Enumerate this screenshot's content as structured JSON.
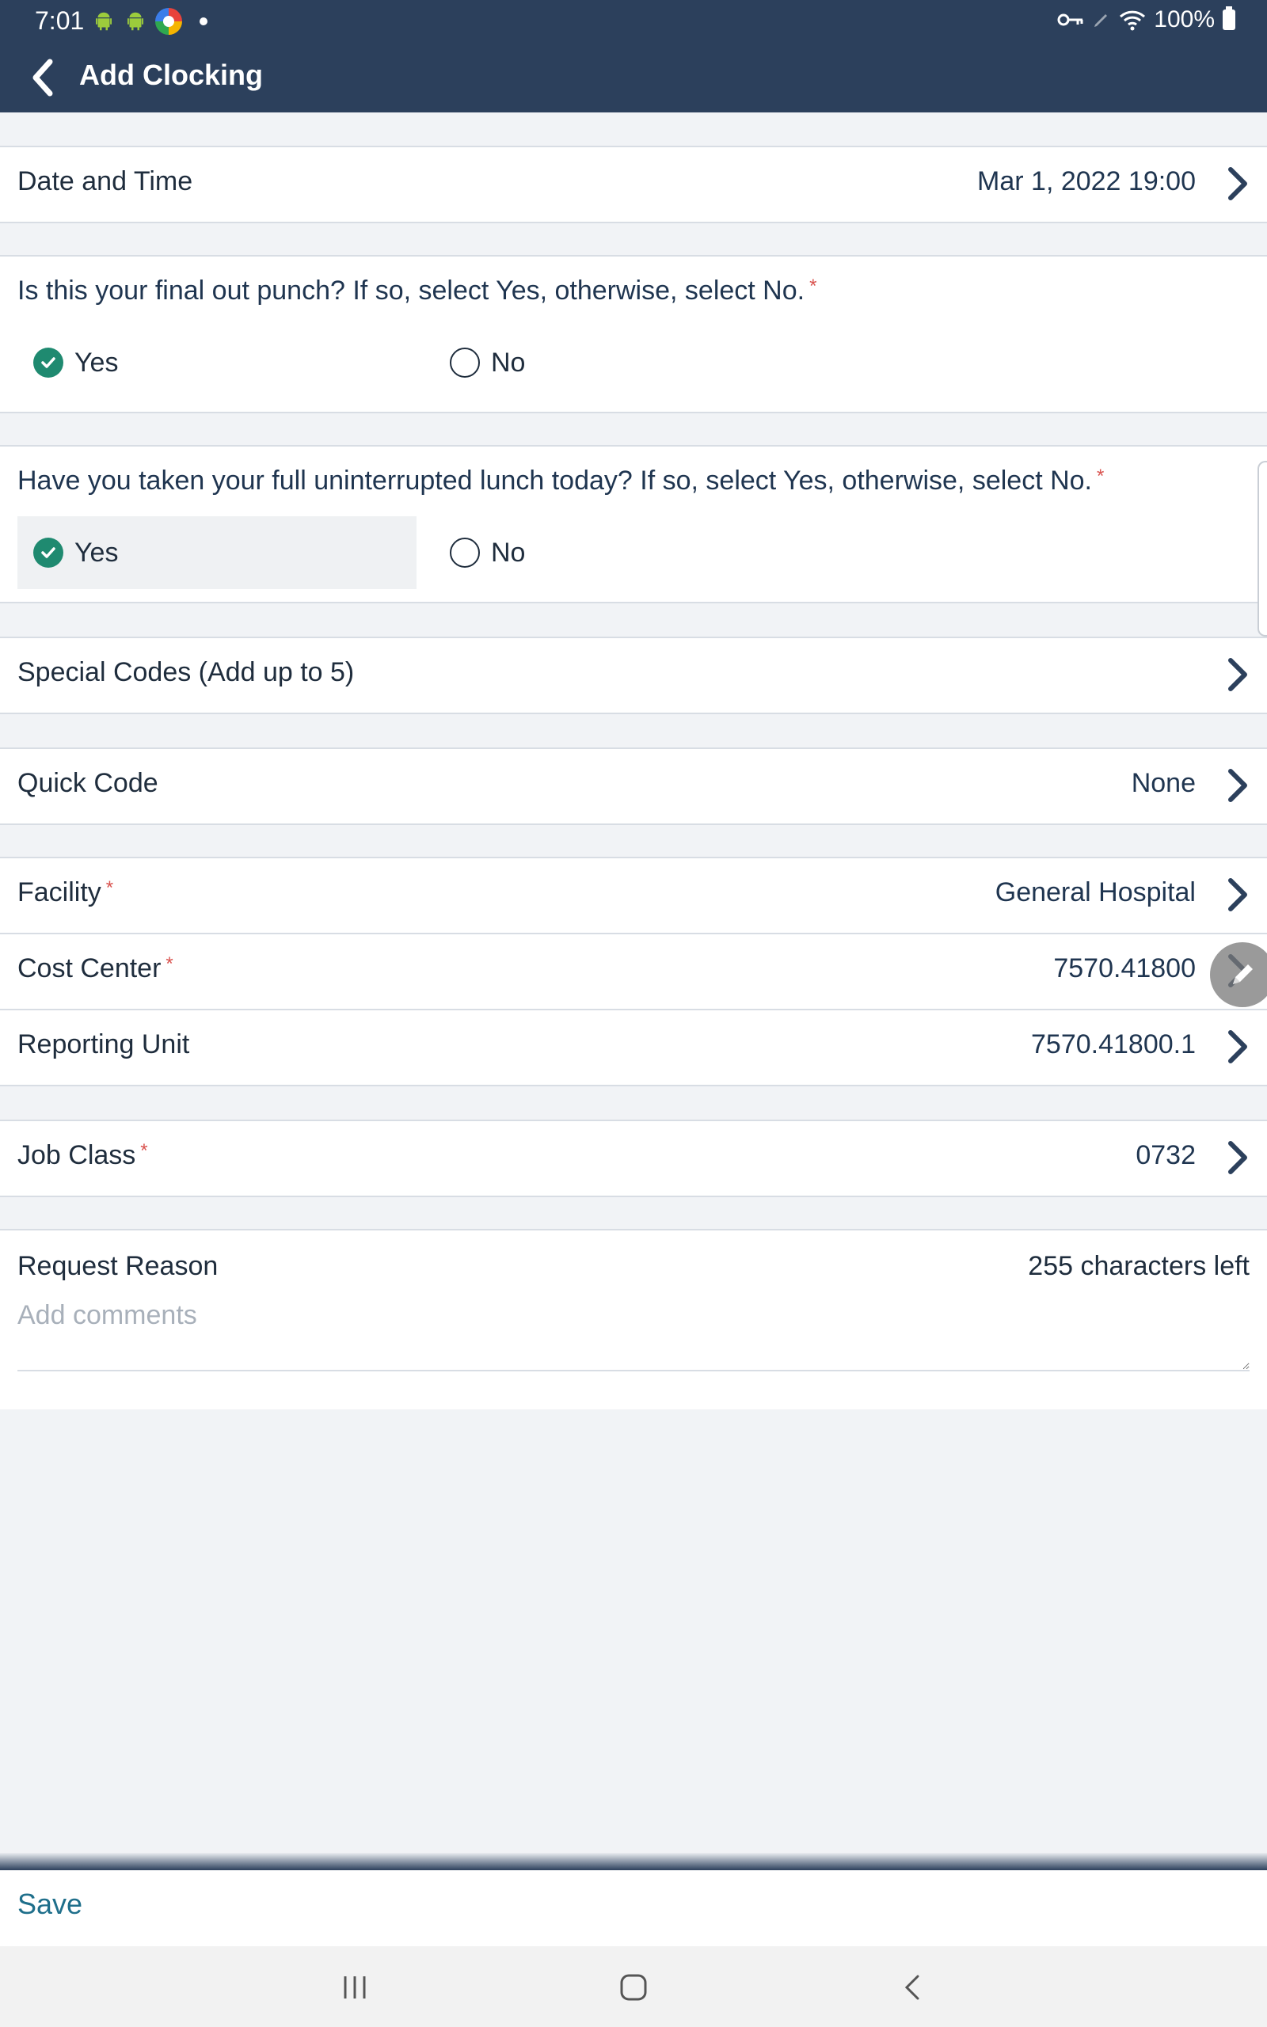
{
  "status_bar": {
    "time": "7:01",
    "battery": "100%",
    "icons": [
      "android-icon",
      "android-icon",
      "browser-icon",
      "dot-icon",
      "key-icon",
      "pencil-icon",
      "wifi-icon",
      "battery-icon"
    ]
  },
  "header": {
    "title": "Add Clocking",
    "back_icon": "chevron-left-icon",
    "background": "#2c405c"
  },
  "date_time": {
    "label": "Date and Time",
    "value": "Mar 1, 2022 19:00"
  },
  "final_punch": {
    "question": "Is this your final out punch? If so, select Yes, otherwise, select No.",
    "required_mark": "*",
    "options": [
      "Yes",
      "No"
    ],
    "selected": "Yes"
  },
  "lunch": {
    "question": "Have you taken your full uninterrupted lunch today? If so, select Yes, otherwise, select No.",
    "required_mark": "*",
    "options": [
      "Yes",
      "No"
    ],
    "selected": "Yes"
  },
  "special_codes": {
    "label": "Special Codes (Add up to 5)"
  },
  "quick_code": {
    "label": "Quick Code",
    "value": "None"
  },
  "facility": {
    "label": "Facility",
    "required_mark": "*",
    "value": "General Hospital"
  },
  "cost_center": {
    "label": "Cost Center",
    "required_mark": "*",
    "value": "7570.41800"
  },
  "reporting_unit": {
    "label": "Reporting Unit",
    "value": "7570.41800.1"
  },
  "job_class": {
    "label": "Job Class",
    "required_mark": "*",
    "value": "0732"
  },
  "request_reason": {
    "label": "Request Reason",
    "chars_left": "255 characters left",
    "placeholder": "Add comments",
    "value": ""
  },
  "footer": {
    "save_label": "Save"
  },
  "nav": {
    "icons": [
      "recent-apps-icon",
      "home-icon",
      "back-icon"
    ]
  },
  "colors": {
    "accent": "#1f8a70",
    "chevron": "#2c405c",
    "required": "#d9534f",
    "save": "#1f6f8b"
  }
}
